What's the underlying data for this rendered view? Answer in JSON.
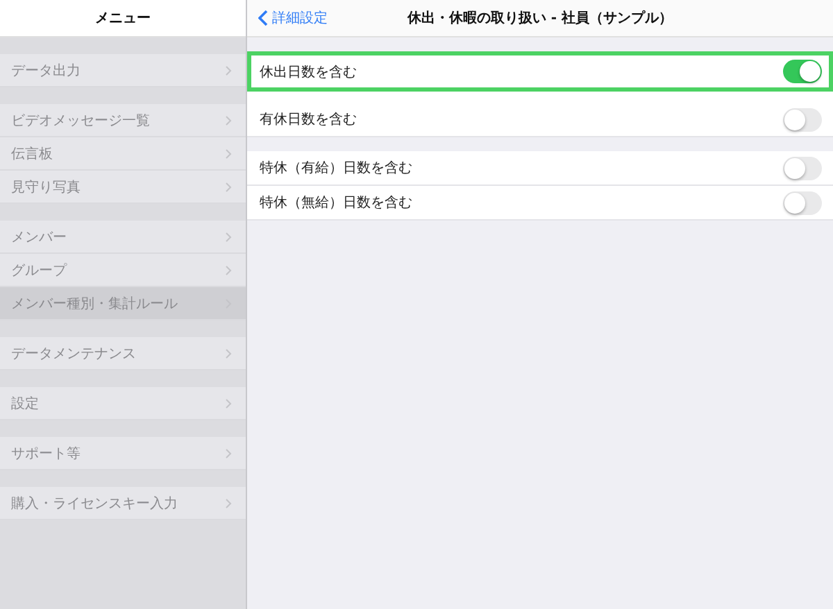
{
  "sidebar": {
    "title": "メニュー",
    "groups": [
      {
        "items": [
          {
            "label": "データ出力",
            "selected": false
          }
        ]
      },
      {
        "items": [
          {
            "label": "ビデオメッセージ一覧",
            "selected": false
          },
          {
            "label": "伝言板",
            "selected": false
          },
          {
            "label": "見守り写真",
            "selected": false
          }
        ]
      },
      {
        "items": [
          {
            "label": "メンバー",
            "selected": false
          },
          {
            "label": "グループ",
            "selected": false
          },
          {
            "label": "メンバー種別・集計ルール",
            "selected": true
          }
        ]
      },
      {
        "items": [
          {
            "label": "データメンテナンス",
            "selected": false
          }
        ]
      },
      {
        "items": [
          {
            "label": "設定",
            "selected": false
          }
        ]
      },
      {
        "items": [
          {
            "label": "サポート等",
            "selected": false
          }
        ]
      },
      {
        "items": [
          {
            "label": "購入・ライセンスキー入力",
            "selected": false
          }
        ]
      }
    ]
  },
  "detail": {
    "back": "詳細設定",
    "title": "休出・休暇の取り扱い - 社員（サンプル）",
    "groups": [
      {
        "items": [
          {
            "label": "休出日数を含む",
            "on": true,
            "highlighted": true
          },
          {
            "label": "有休日数を含む",
            "on": false,
            "highlighted": false
          }
        ]
      },
      {
        "items": [
          {
            "label": "特休（有給）日数を含む",
            "on": false,
            "highlighted": false
          },
          {
            "label": "特休（無給）日数を含む",
            "on": false,
            "highlighted": false
          }
        ]
      }
    ]
  }
}
